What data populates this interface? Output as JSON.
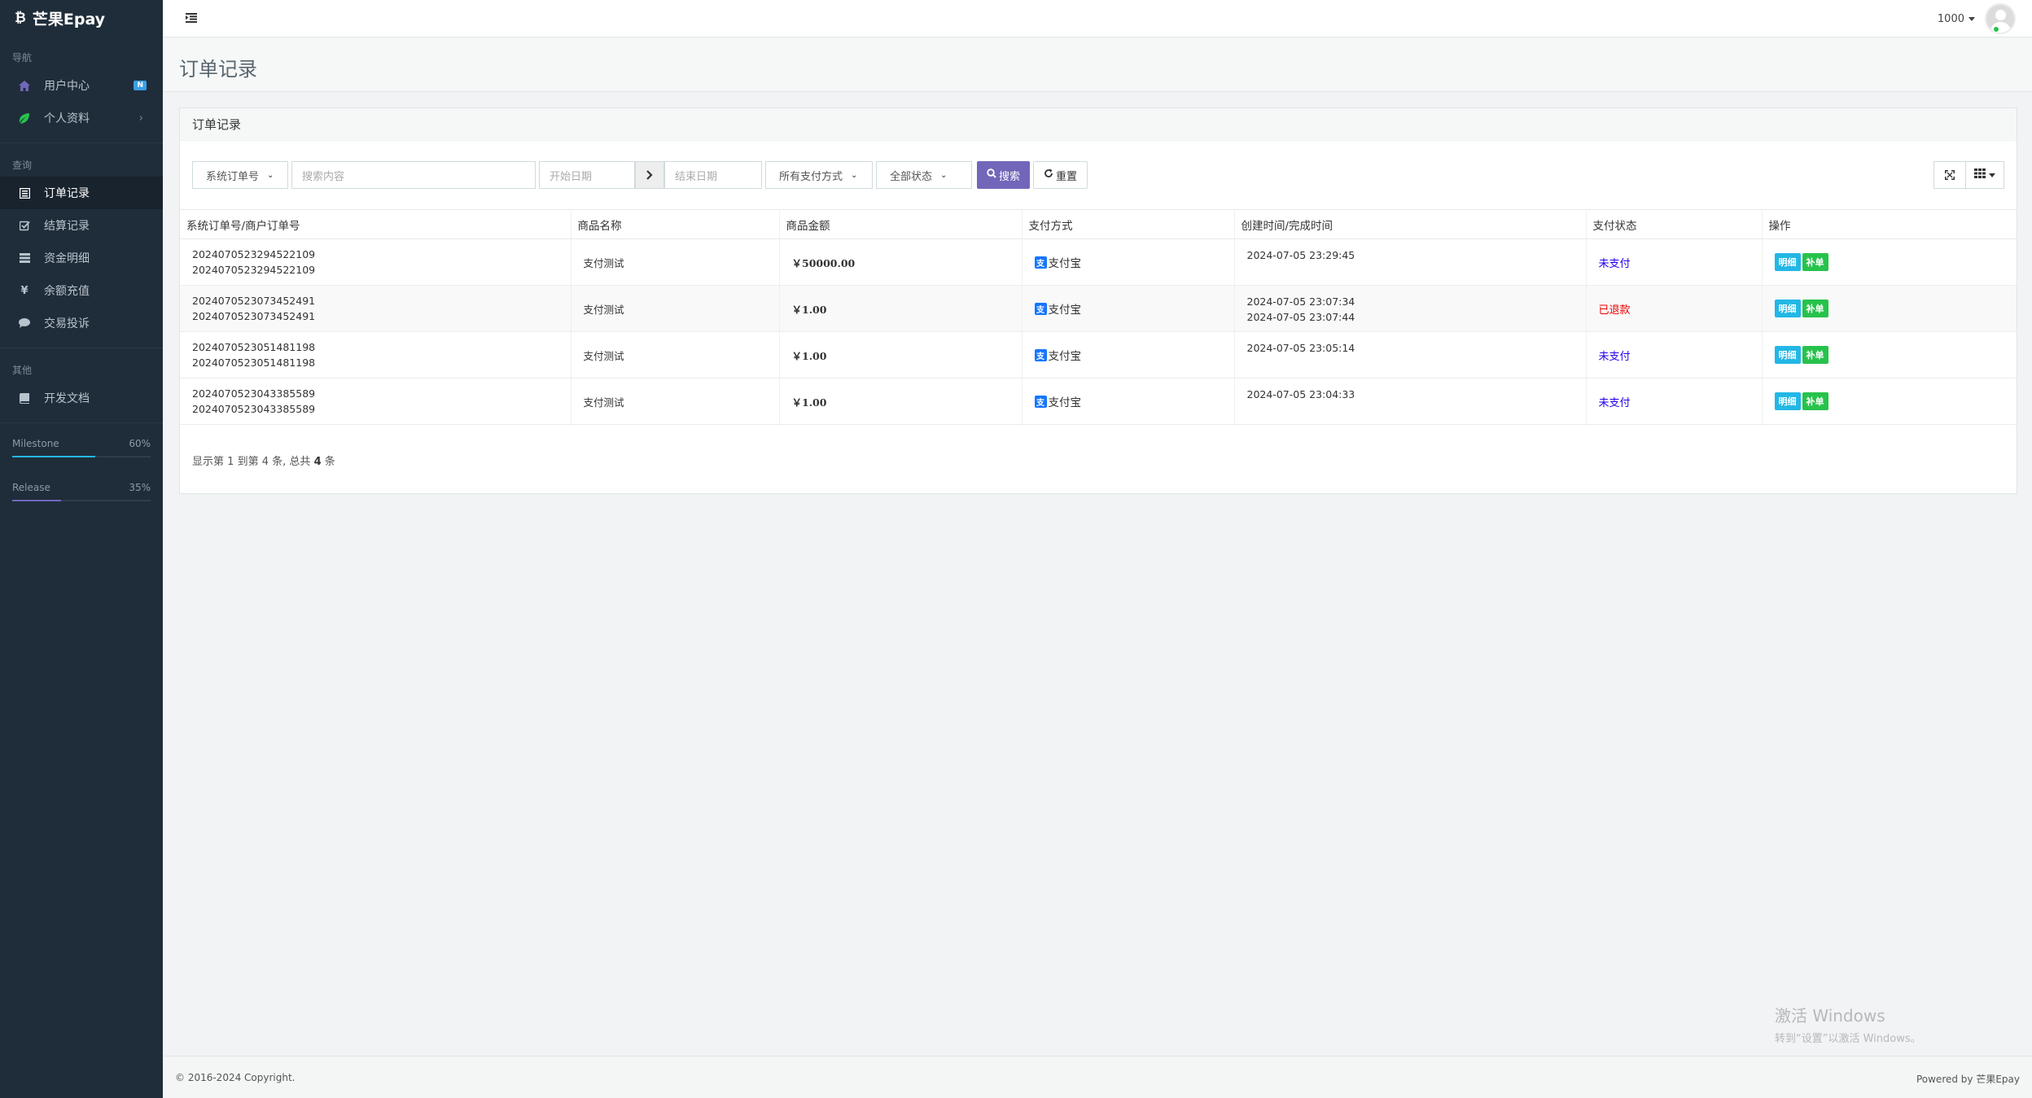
{
  "app": {
    "brand": "芒果Epay",
    "brand_icon": "bitcoin-icon"
  },
  "sidebar": {
    "sections": [
      {
        "header": "导航",
        "items": [
          {
            "label": "用户中心",
            "icon": "home-icon",
            "badge": "N",
            "icon_color": "#7266ba"
          },
          {
            "label": "个人资料",
            "icon": "leaf-icon",
            "chevron": "›",
            "icon_color": "#27c24c"
          }
        ]
      },
      {
        "header": "查询",
        "items": [
          {
            "label": "订单记录",
            "icon": "list-alt-icon",
            "active": true
          },
          {
            "label": "结算记录",
            "icon": "check-square-icon"
          },
          {
            "label": "资金明细",
            "icon": "table-icon"
          },
          {
            "label": "余额充值",
            "icon": "yen-icon"
          },
          {
            "label": "交易投诉",
            "icon": "comment-icon"
          }
        ]
      },
      {
        "header": "其他",
        "items": [
          {
            "label": "开发文档",
            "icon": "book-icon"
          }
        ]
      }
    ],
    "progress": [
      {
        "label": "Milestone",
        "value_text": "60%",
        "value": 60,
        "color": "#23b7e5"
      },
      {
        "label": "Release",
        "value_text": "35%",
        "value": 35,
        "color": "#7266ba"
      }
    ]
  },
  "topbar": {
    "menu_icon": "indent-icon",
    "user": "1000"
  },
  "page": {
    "title": "订单记录"
  },
  "panel": {
    "heading": "订单记录"
  },
  "filters": {
    "type_select": "系统订单号",
    "search_placeholder": "搜索内容",
    "start_placeholder": "开始日期",
    "end_placeholder": "结束日期",
    "pay_select": "所有支付方式",
    "status_select": "全部状态",
    "search_label": "搜索",
    "reset_label": "重置"
  },
  "table": {
    "columns": [
      "系统订单号/商户订单号",
      "商品名称",
      "商品金额",
      "支付方式",
      "创建时间/完成时间",
      "支付状态",
      "操作"
    ],
    "rows": [
      {
        "order_no": "2024070523294522109",
        "merchant_no": "2024070523294522109",
        "product": "支付测试",
        "amount": "￥50000.00",
        "pay": "支付宝",
        "created": "2024-07-05 23:29:45",
        "completed": "",
        "status": "未支付",
        "status_type": "unpaid"
      },
      {
        "order_no": "2024070523073452491",
        "merchant_no": "2024070523073452491",
        "product": "支付测试",
        "amount": "￥1.00",
        "pay": "支付宝",
        "created": "2024-07-05 23:07:34",
        "completed": "2024-07-05 23:07:44",
        "status": "已退款",
        "status_type": "refund"
      },
      {
        "order_no": "2024070523051481198",
        "merchant_no": "2024070523051481198",
        "product": "支付测试",
        "amount": "￥1.00",
        "pay": "支付宝",
        "created": "2024-07-05 23:05:14",
        "completed": "",
        "status": "未支付",
        "status_type": "unpaid"
      },
      {
        "order_no": "2024070523043385589",
        "merchant_no": "2024070523043385589",
        "product": "支付测试",
        "amount": "￥1.00",
        "pay": "支付宝",
        "created": "2024-07-05 23:04:33",
        "completed": "",
        "status": "未支付",
        "status_type": "unpaid"
      }
    ],
    "op_detail": "明细",
    "op_fix": "补单"
  },
  "pagination": {
    "pre": "显示第",
    "from": "1",
    "mid": "到第",
    "to": "4",
    "unit": "条, 总共",
    "total": "4",
    "post": "条"
  },
  "watermark": {
    "title": "激活 Windows",
    "subtitle": "转到“设置”以激活 Windows。"
  },
  "footer": {
    "copyright": "© 2016-2024 Copyright.",
    "powered": "Powered by 芒果Epay"
  }
}
